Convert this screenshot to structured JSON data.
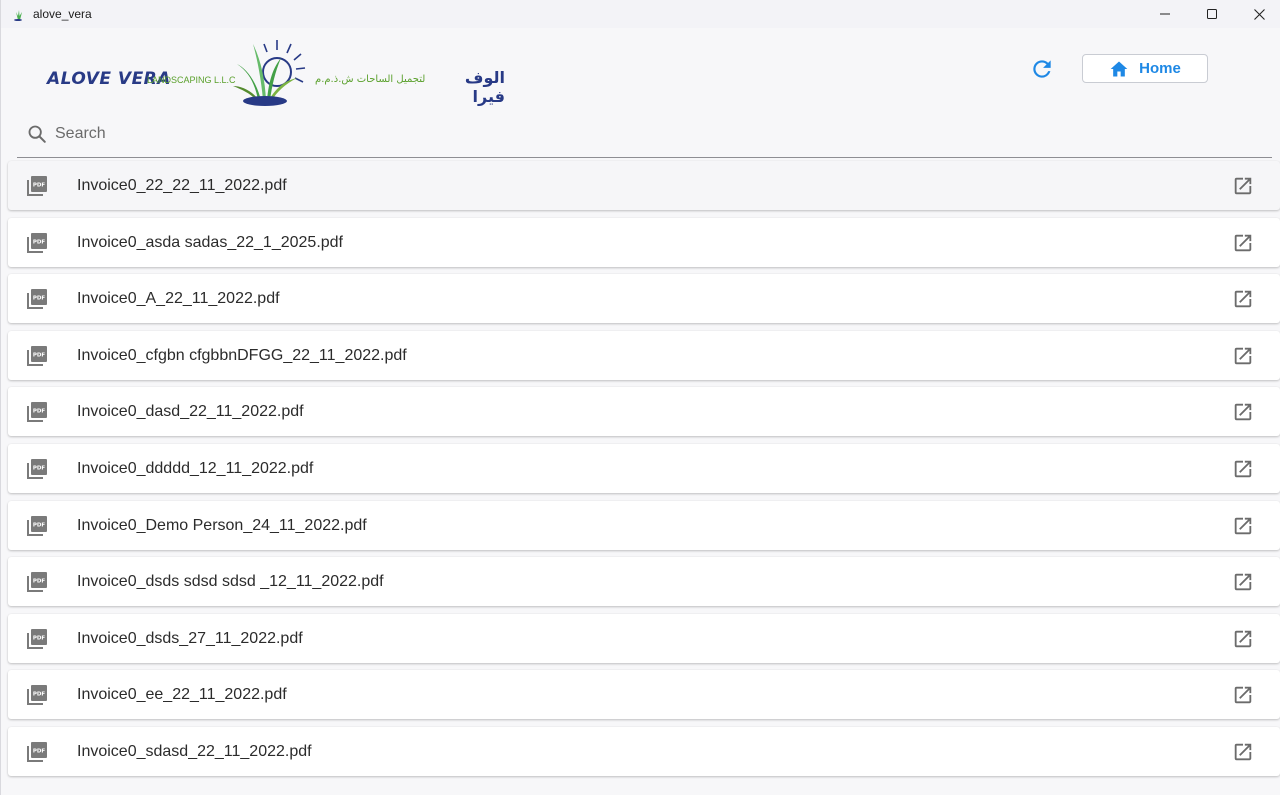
{
  "window": {
    "title": "alove_vera",
    "icons": {
      "app": "aloe-plant-icon",
      "minimize": "minimize-icon",
      "maximize": "maximize-icon",
      "close": "close-icon"
    }
  },
  "header": {
    "logo": {
      "english": "ALOVE VERA",
      "suffix": "LANDSCAPING L.L.C",
      "arabic": "الوف فيرا",
      "arabic_sub": "لتجميل الساحات ش.ذ.م.م"
    },
    "refresh_icon": "refresh-icon",
    "home_label": "Home",
    "home_icon": "home-icon",
    "accent": "#1e88e5"
  },
  "search": {
    "placeholder": "Search",
    "value": ""
  },
  "files": [
    {
      "name": "Invoice0_22_22_11_2022.pdf"
    },
    {
      "name": "Invoice0_asda sadas_22_1_2025.pdf"
    },
    {
      "name": "Invoice0_A_22_11_2022.pdf"
    },
    {
      "name": "Invoice0_cfgbn cfgbbnDFGG_22_11_2022.pdf"
    },
    {
      "name": "Invoice0_dasd_22_11_2022.pdf"
    },
    {
      "name": "Invoice0_ddddd_12_11_2022.pdf"
    },
    {
      "name": "Invoice0_Demo Person_24_11_2022.pdf"
    },
    {
      "name": "Invoice0_dsds sdsd sdsd _12_11_2022.pdf"
    },
    {
      "name": "Invoice0_dsds_27_11_2022.pdf"
    },
    {
      "name": "Invoice0_ee_22_11_2022.pdf"
    },
    {
      "name": "Invoice0_sdasd_22_11_2022.pdf"
    }
  ]
}
